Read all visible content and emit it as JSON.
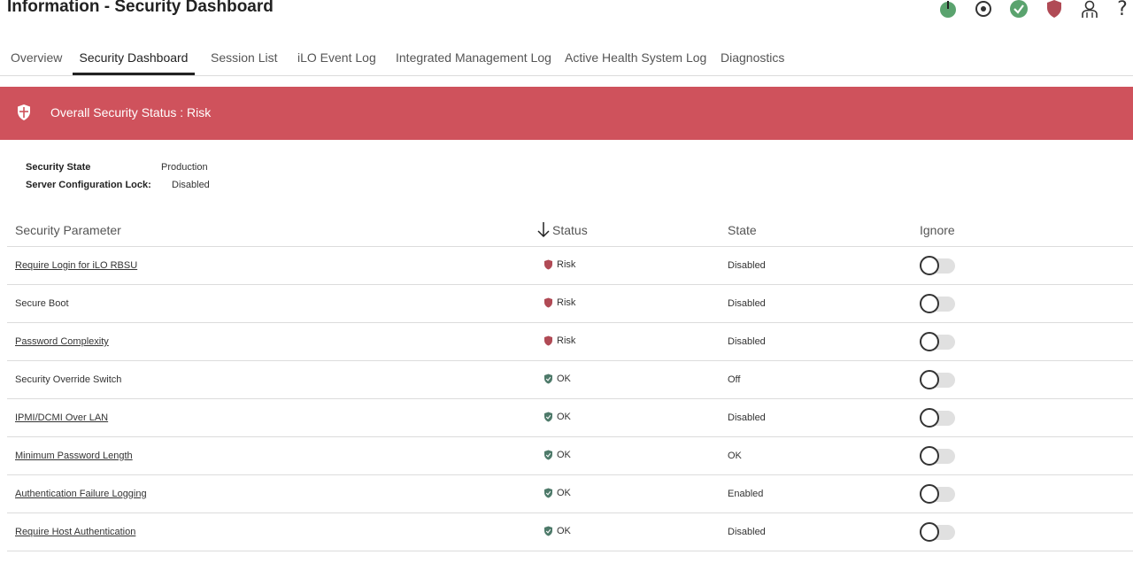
{
  "header": {
    "title": "Information - Security Dashboard",
    "icons": [
      "power-icon",
      "target-icon",
      "health-ok-icon",
      "security-shield-icon",
      "user-icon",
      "help-icon"
    ]
  },
  "tabs": [
    {
      "label": "Overview",
      "active": false
    },
    {
      "label": "Security Dashboard",
      "active": true
    },
    {
      "label": "Session List",
      "active": false
    },
    {
      "label": "iLO Event Log",
      "active": false
    },
    {
      "label": "Integrated Management Log",
      "active": false
    },
    {
      "label": "Active Health System Log",
      "active": false
    },
    {
      "label": "Diagnostics",
      "active": false
    }
  ],
  "banner": {
    "text": "Overall Security Status : Risk",
    "color": "#cf525c"
  },
  "info": {
    "security_state_label": "Security State",
    "security_state_value": "Production",
    "config_lock_label": "Server Configuration Lock:",
    "config_lock_value": "Disabled"
  },
  "table": {
    "headers": {
      "parameter": "Security Parameter",
      "status": "Status",
      "state": "State",
      "ignore": "Ignore"
    },
    "rows": [
      {
        "parameter": "Require Login for iLO RBSU",
        "link": true,
        "status": "Risk",
        "state": "Disabled",
        "ignore": false
      },
      {
        "parameter": "Secure Boot",
        "link": false,
        "status": "Risk",
        "state": "Disabled",
        "ignore": false
      },
      {
        "parameter": "Password Complexity",
        "link": true,
        "status": "Risk",
        "state": "Disabled",
        "ignore": false
      },
      {
        "parameter": "Security Override Switch",
        "link": false,
        "status": "OK",
        "state": "Off",
        "ignore": false
      },
      {
        "parameter": "IPMI/DCMI Over LAN",
        "link": true,
        "status": "OK",
        "state": "Disabled",
        "ignore": false
      },
      {
        "parameter": "Minimum Password Length",
        "link": true,
        "status": "OK",
        "state": "OK",
        "ignore": false
      },
      {
        "parameter": "Authentication Failure Logging",
        "link": true,
        "status": "OK",
        "state": "Enabled",
        "ignore": false
      },
      {
        "parameter": "Require Host Authentication",
        "link": true,
        "status": "OK",
        "state": "Disabled",
        "ignore": false
      }
    ]
  },
  "colors": {
    "risk": "#b04a55",
    "ok": "#4e7a6a",
    "health_green": "#5aa36e",
    "banner": "#cf525c"
  }
}
